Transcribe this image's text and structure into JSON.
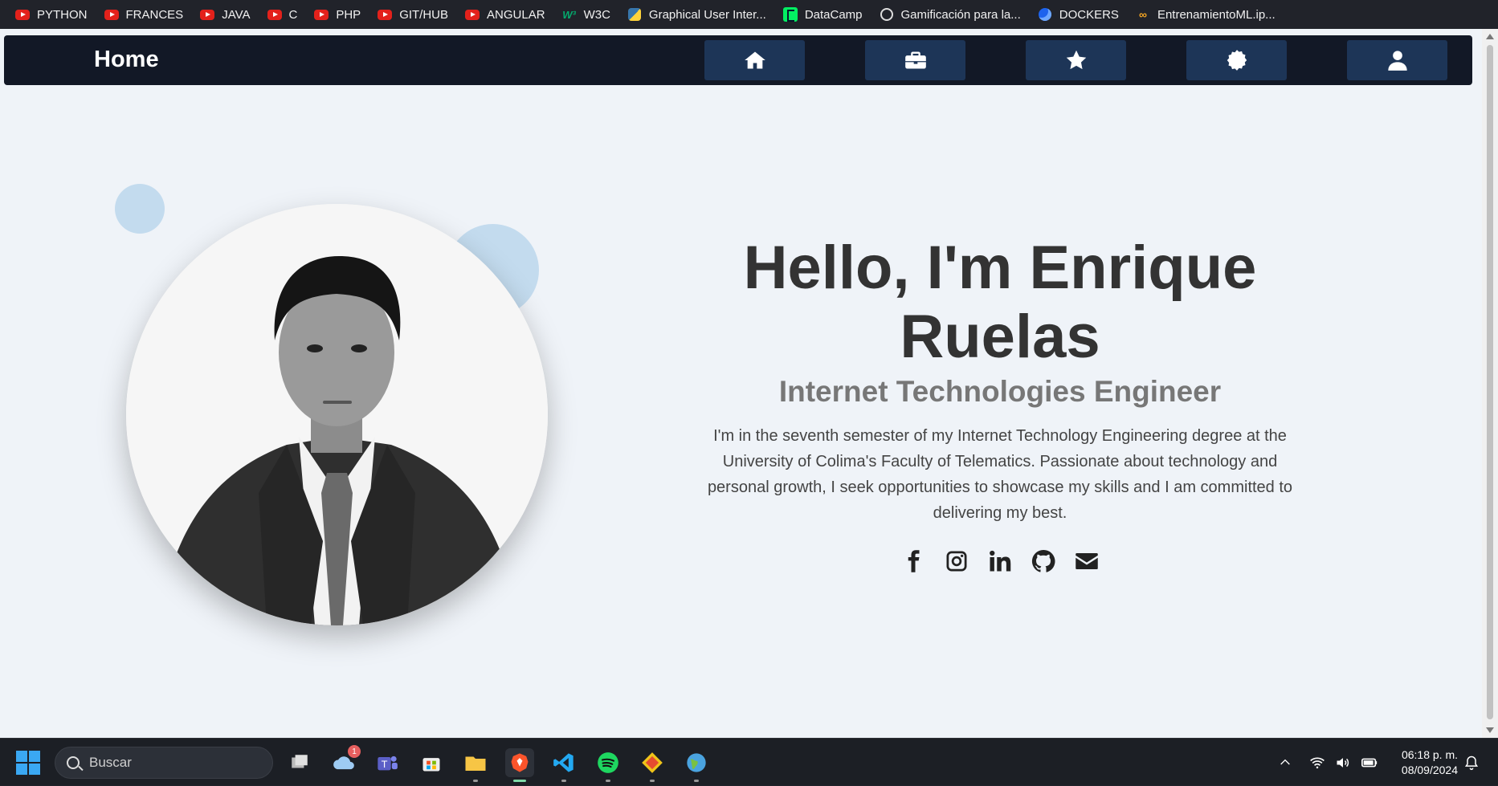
{
  "bookmarks": [
    {
      "label": "PYTHON",
      "icon": "youtube-icon"
    },
    {
      "label": "FRANCES",
      "icon": "youtube-icon"
    },
    {
      "label": "JAVA",
      "icon": "youtube-icon"
    },
    {
      "label": "C",
      "icon": "youtube-icon"
    },
    {
      "label": "PHP",
      "icon": "youtube-icon"
    },
    {
      "label": "GIT/HUB",
      "icon": "youtube-icon"
    },
    {
      "label": "ANGULAR",
      "icon": "youtube-icon"
    },
    {
      "label": "W3C",
      "icon": "w3schools-icon"
    },
    {
      "label": "Graphical User Inter...",
      "icon": "python-icon"
    },
    {
      "label": "DataCamp",
      "icon": "datacamp-icon"
    },
    {
      "label": "Gamificación para la...",
      "icon": "globe-icon"
    },
    {
      "label": "DOCKERS",
      "icon": "docker-icon"
    },
    {
      "label": "EntrenamientoML.ip...",
      "icon": "infinity-icon"
    }
  ],
  "navbar": {
    "brand": "Home",
    "buttons": [
      "home-icon",
      "briefcase-icon",
      "star-icon",
      "badge-icon",
      "user-icon"
    ]
  },
  "hero": {
    "title": "Hello, I'm Enrique Ruelas",
    "subtitle": "Internet Technologies Engineer",
    "description": "I'm in the seventh semester of my Internet Technology Engineering degree at the University of Colima's Faculty of Telematics. Passionate about technology and personal growth, I seek opportunities to showcase my skills and I am committed to delivering my best.",
    "socials": [
      "facebook-icon",
      "instagram-icon",
      "linkedin-icon",
      "github-icon",
      "envelope-icon"
    ]
  },
  "taskbar": {
    "search_placeholder": "Buscar",
    "weather_badge": "1",
    "time": "06:18 p. m.",
    "date": "08/09/2024"
  },
  "colors": {
    "navbar_bg": "#121826",
    "nav_button_bg": "#1d3557",
    "page_bg": "#eff3f8",
    "accent_blob": "#c3dbee"
  }
}
